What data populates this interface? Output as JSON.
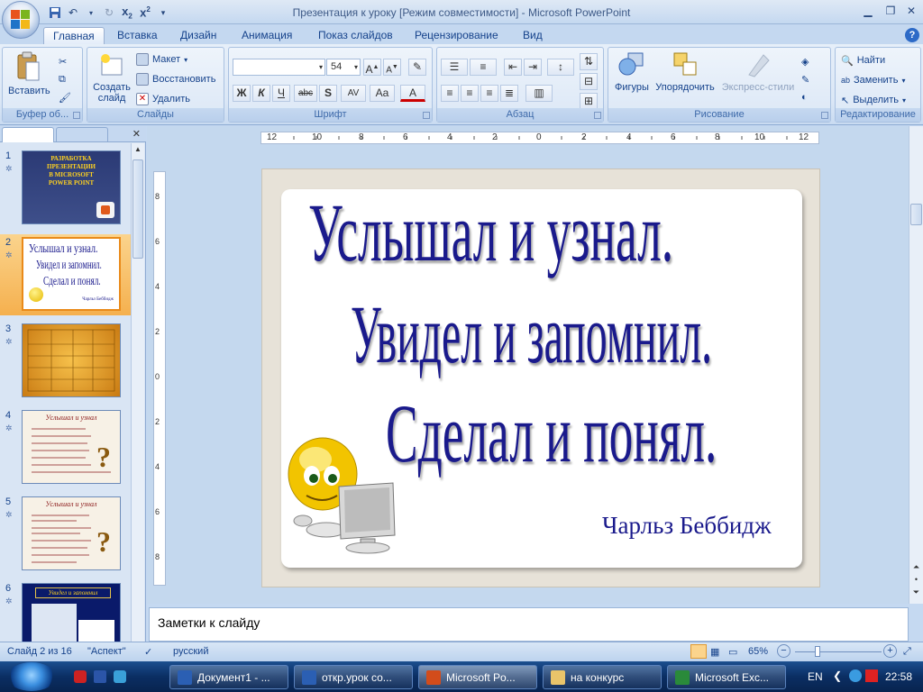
{
  "window": {
    "title": "Презентация к уроку [Режим совместимости] - Microsoft PowerPoint"
  },
  "tabs": [
    "Главная",
    "Вставка",
    "Дизайн",
    "Анимация",
    "Показ слайдов",
    "Рецензирование",
    "Вид"
  ],
  "ribbon": {
    "clipboard": {
      "label": "Буфер об...",
      "paste": "Вставить"
    },
    "slides": {
      "label": "Слайды",
      "new_slide_1": "Создать",
      "new_slide_2": "слайд",
      "layout": "Макет",
      "reset": "Восстановить",
      "delete": "Удалить"
    },
    "font": {
      "label": "Шрифт",
      "font_name": "",
      "font_size": "54",
      "bold": "Ж",
      "italic": "К",
      "underline": "Ч",
      "strike": "abc",
      "shadow": "S",
      "spacing": "AV",
      "case": "Aa",
      "color": "A",
      "grow": "A",
      "shrink": "A"
    },
    "paragraph": {
      "label": "Абзац"
    },
    "drawing": {
      "label": "Рисование",
      "shapes": "Фигуры",
      "arrange": "Упорядочить",
      "styles": "Экспресс-стили"
    },
    "editing": {
      "label": "Редактирование",
      "find": "Найти",
      "replace": "Заменить",
      "select": "Выделить"
    }
  },
  "ruler": {
    "h_labels": [
      "12",
      "10",
      "8",
      "6",
      "4",
      "2",
      "0",
      "2",
      "4",
      "6",
      "8",
      "10",
      "12"
    ],
    "v_labels": [
      "8",
      "6",
      "4",
      "2",
      "0",
      "2",
      "4",
      "6",
      "8"
    ]
  },
  "thumbnails": [
    {
      "num": "1",
      "lines": [
        "РАЗРАБОТКА",
        "ПРЕЗЕНТАЦИИ",
        "В MICROSOFT",
        "POWER POINT"
      ]
    },
    {
      "num": "2",
      "lines": [
        "Услышал и узнал.",
        "Увидел и запомнил.",
        "Сделал и понял."
      ],
      "author": "Чарльз Беббидж"
    },
    {
      "num": "3"
    },
    {
      "num": "4",
      "title": "Услышал и узнал"
    },
    {
      "num": "5",
      "title": "Услышал и узнал"
    },
    {
      "num": "6",
      "title": "Увидел и запомнил"
    }
  ],
  "slide": {
    "line1": "Услышал и узнал.",
    "line2": "Увидел и запомнил.",
    "line3": "Сделал и понял.",
    "author": "Чарльз Беббидж"
  },
  "notes": {
    "placeholder": "Заметки к слайду"
  },
  "status": {
    "slide_of": "Слайд 2 из 16",
    "theme": "\"Аспект\"",
    "language": "русский",
    "zoom": "65%"
  },
  "taskbar": {
    "buttons": [
      "Документ1 - ...",
      "откр.урок  со...",
      "Microsoft Po...",
      "на конкурс",
      "Microsoft Exc..."
    ],
    "lang": "EN",
    "time": "22:58"
  },
  "colors": {
    "slide_text": "#1a1a8c",
    "selected_thumb": "#f5b04e",
    "ribbon_bg": "#dbe7f6"
  }
}
